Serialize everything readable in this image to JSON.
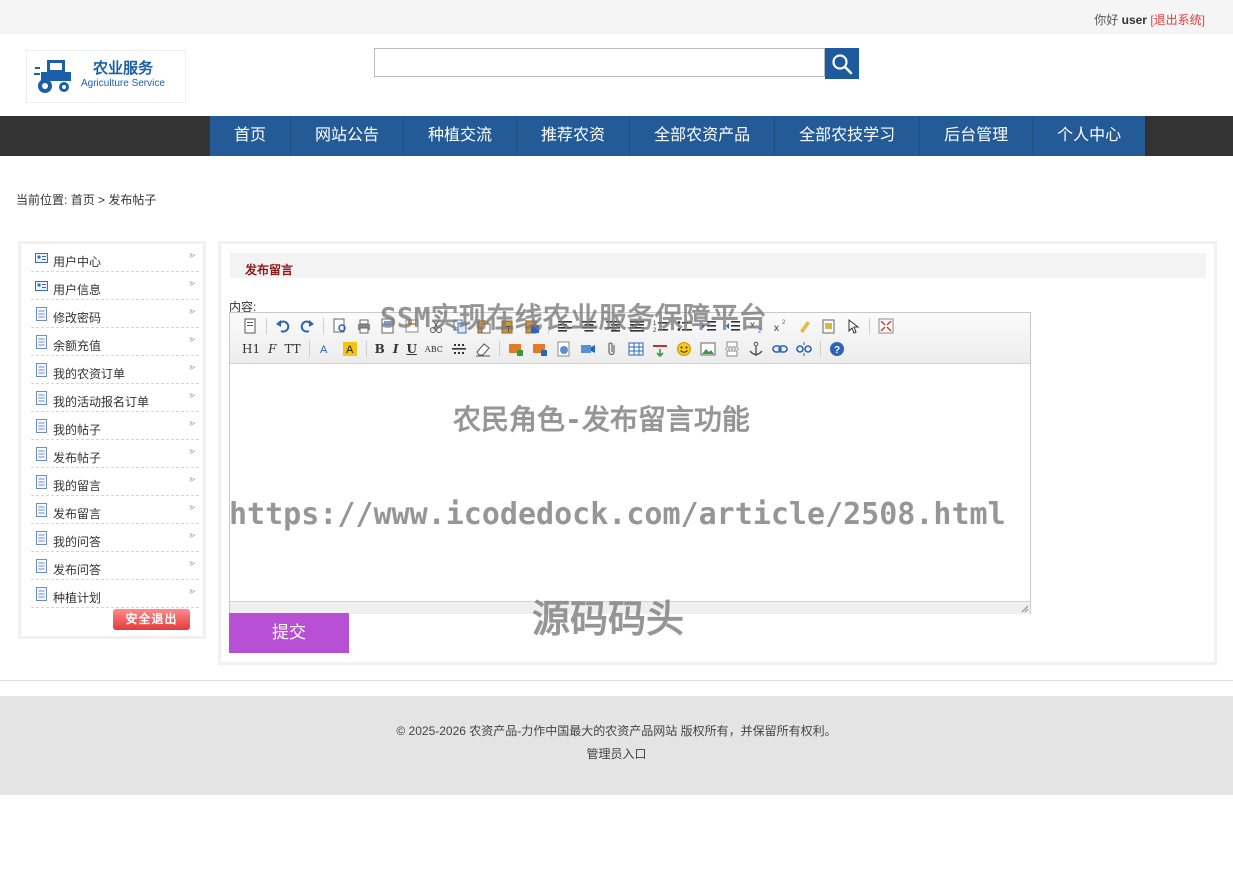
{
  "header": {
    "greeting": "你好",
    "username": "user",
    "logout_link": "[退出系统]"
  },
  "logo": {
    "title_cn": "农业服务",
    "title_en": "Agriculture Service"
  },
  "search": {
    "value": "",
    "placeholder": ""
  },
  "nav": {
    "items": [
      "首页",
      "网站公告",
      "种植交流",
      "推荐农资",
      "全部农资产品",
      "全部农技学习",
      "后台管理",
      "个人中心"
    ]
  },
  "breadcrumb": {
    "prefix": "当前位置:",
    "home": "首页",
    "separator": ">",
    "current": "发布帖子"
  },
  "sidebar": {
    "items": [
      "用户中心",
      "用户信息",
      "修改密码",
      "余额充值",
      "我的农资订单",
      "我的活动报名订单",
      "我的帖子",
      "发布帖子",
      "我的留言",
      "发布留言",
      "我的问答",
      "发布问答",
      "种植计划"
    ],
    "logout_label": "安全退出"
  },
  "main": {
    "title": "发布留言",
    "content_label": "内容:",
    "editor": {
      "heading_btn": "H1",
      "font_btn": "F",
      "size_btn": "TT",
      "bold": "B",
      "italic": "I",
      "underline": "U",
      "strike": "ABC"
    },
    "submit_label": "提交"
  },
  "footer": {
    "copyright": "© 2025-2026 农资产品-力作中国最大的农资产品网站 版权所有，并保留所有权利。",
    "admin_link": "管理员入口"
  },
  "watermarks": {
    "line1": "SSM实现在线农业服务保障平台",
    "line2": "农民角色-发布留言功能",
    "line3": "https://www.icodedock.com/article/2508.html",
    "line4": "源码码头"
  },
  "colors": {
    "nav_bg": "#245a96",
    "nav_bar": "#333333",
    "submit": "#b850d6",
    "title_red": "#8b1c1c",
    "logout_red": "#e23c3c"
  }
}
